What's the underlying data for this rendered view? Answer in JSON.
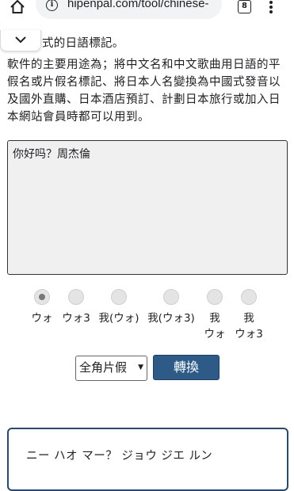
{
  "browser": {
    "url": "hipenpal.com/tool/chinese-",
    "tab_count": "8"
  },
  "intro": {
    "line1": "式的日語標記。",
    "paragraph": "軟件的主要用途為；將中文名和中文歌曲用日語的平假名或片假名標記、將日本人名變換為中國式發音以及國外直購、日本酒店預訂、計劃日本旅行或加入日本網站會員時都可以用到。"
  },
  "input": {
    "value": "你好吗？周杰倫"
  },
  "options": [
    {
      "label": "ウォ",
      "selected": true
    },
    {
      "label": "ウォ3",
      "selected": false
    },
    {
      "label": "我(ウォ)",
      "selected": false
    },
    {
      "label": "我(ウォ3)",
      "selected": false
    },
    {
      "label": "我\nウォ",
      "selected": false
    },
    {
      "label": "我\nウォ3",
      "selected": false
    }
  ],
  "controls": {
    "select_value": "全角片假",
    "convert_label": "轉換"
  },
  "output": {
    "text": "ニー ハオ マー？ ジョウ ジエ ルン"
  }
}
